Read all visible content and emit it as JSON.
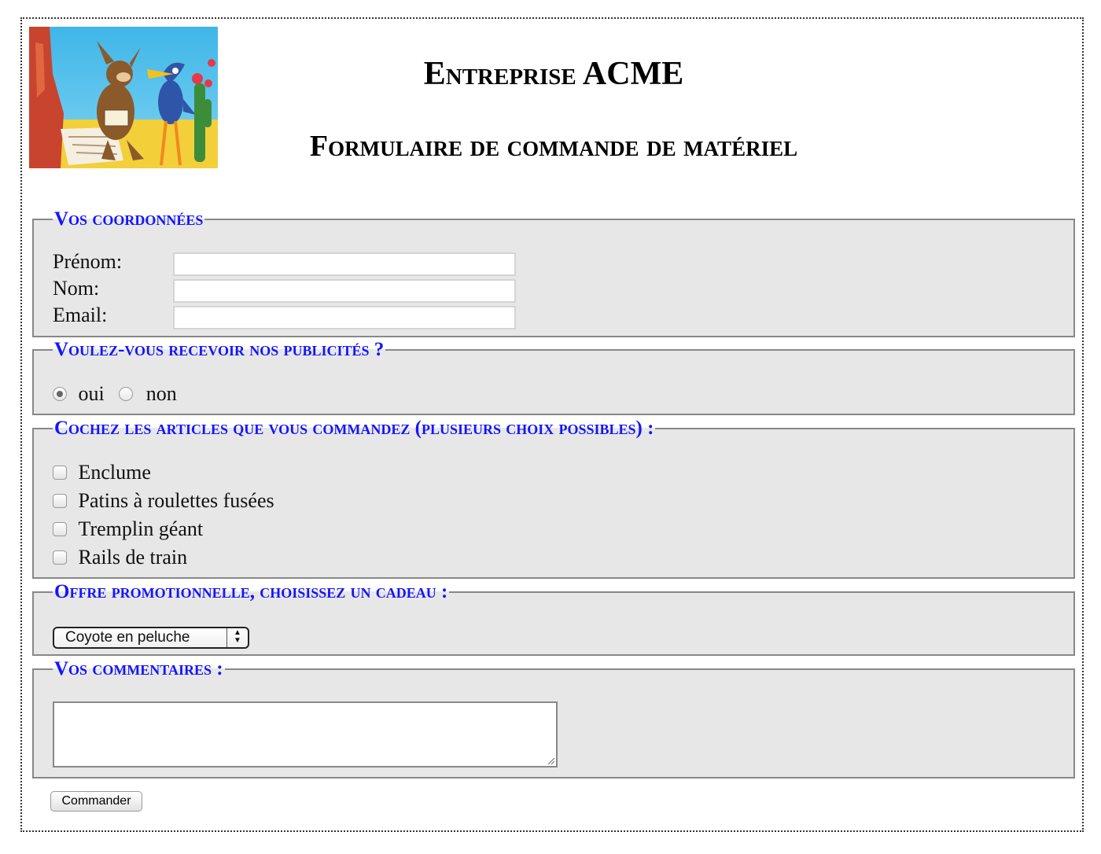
{
  "header": {
    "title": "Entreprise ACME",
    "subtitle": "Formulaire de commande de matériel"
  },
  "coordonnees": {
    "legend": "Vos coordonnées",
    "fields": [
      {
        "label": "Prénom:",
        "value": ""
      },
      {
        "label": "Nom:",
        "value": ""
      },
      {
        "label": "Email:",
        "value": ""
      }
    ]
  },
  "publicites": {
    "legend": "Voulez-vous recevoir nos publicités ?",
    "options": [
      {
        "label": "oui",
        "checked": true
      },
      {
        "label": "non",
        "checked": false
      }
    ]
  },
  "articles": {
    "legend": "Cochez les articles que vous commandez (plusieurs choix possibles) :",
    "items": [
      {
        "label": "Enclume",
        "checked": false
      },
      {
        "label": "Patins à roulettes fusées",
        "checked": false
      },
      {
        "label": "Tremplin géant",
        "checked": false
      },
      {
        "label": "Rails de train",
        "checked": false
      }
    ]
  },
  "promo": {
    "legend": "Offre promotionnelle, choisissez un cadeau :",
    "selected": "Coyote en peluche"
  },
  "commentaires": {
    "legend": "Vos commentaires :",
    "value": ""
  },
  "submit_label": "Commander",
  "icons": {
    "logo": "coyote-roadrunner-logo",
    "select_arrows": "up-down-arrows-icon",
    "resize": "resize-grip-icon"
  }
}
